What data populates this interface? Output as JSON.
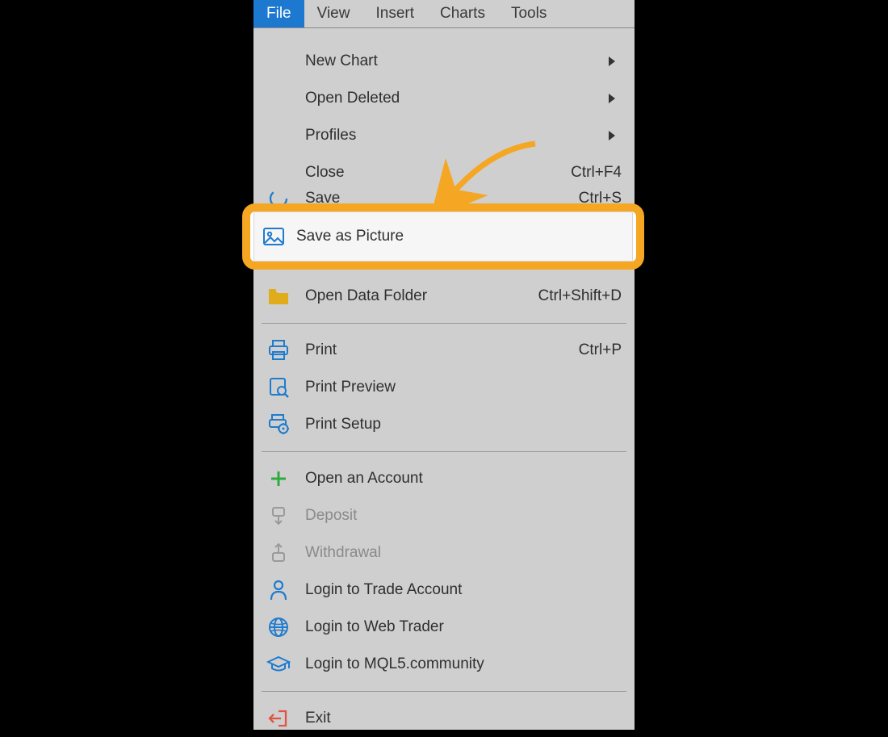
{
  "menubar": {
    "items": [
      {
        "label": "File",
        "active": true
      },
      {
        "label": "View",
        "active": false
      },
      {
        "label": "Insert",
        "active": false
      },
      {
        "label": "Charts",
        "active": false
      },
      {
        "label": "Tools",
        "active": false
      }
    ]
  },
  "menu": {
    "groups": [
      [
        {
          "label": "New Chart",
          "submenu": true
        },
        {
          "label": "Open Deleted",
          "submenu": true
        },
        {
          "label": "Profiles",
          "submenu": true
        },
        {
          "label": "Close",
          "shortcut": "Ctrl+F4"
        },
        {
          "label": "Save",
          "shortcut": "Ctrl+S",
          "icon": "save-icon",
          "partially_hidden": true
        }
      ],
      [
        {
          "label": "Save as Picture",
          "icon": "picture-icon",
          "highlighted": true
        },
        {
          "label": "Open Data Folder",
          "shortcut": "Ctrl+Shift+D",
          "icon": "folder-icon"
        }
      ],
      [
        {
          "label": "Print",
          "shortcut": "Ctrl+P",
          "icon": "print-icon"
        },
        {
          "label": "Print Preview",
          "icon": "print-preview-icon"
        },
        {
          "label": "Print Setup",
          "icon": "print-setup-icon"
        }
      ],
      [
        {
          "label": "Open an Account",
          "icon": "plus-icon"
        },
        {
          "label": "Deposit",
          "icon": "deposit-icon",
          "disabled": true
        },
        {
          "label": "Withdrawal",
          "icon": "withdrawal-icon",
          "disabled": true
        },
        {
          "label": "Login to Trade Account",
          "icon": "user-icon"
        },
        {
          "label": "Login to Web Trader",
          "icon": "globe-icon"
        },
        {
          "label": "Login to MQL5.community",
          "icon": "graduation-cap-icon"
        }
      ],
      [
        {
          "label": "Exit",
          "icon": "exit-icon"
        }
      ]
    ]
  },
  "annotation": {
    "highlight_label": "Save as Picture",
    "highlight_color": "#f5a623"
  },
  "colors": {
    "accent_blue": "#1d79d0",
    "icon_blue": "#1e7bce",
    "folder_yellow": "#e0ac1b",
    "plus_green": "#2faa3e",
    "exit_red": "#e05545",
    "disabled_gray": "#9a9a9a",
    "bg_gray": "#cfcfcf"
  }
}
